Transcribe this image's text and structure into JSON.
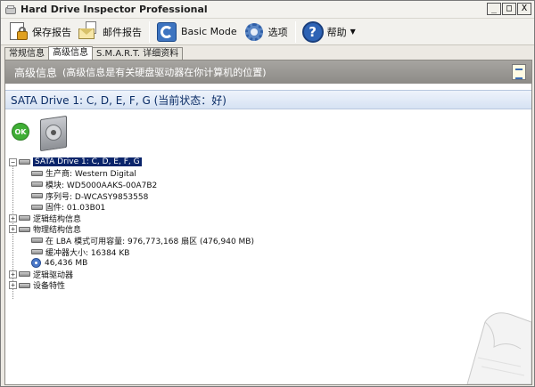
{
  "window": {
    "title": "Hard Drive Inspector Professional"
  },
  "window_buttons": {
    "minimize": "_",
    "maximize": "□",
    "close": "X"
  },
  "toolbar": {
    "save_report": "保存报告",
    "mail_report": "邮件报告",
    "basic_mode": "Basic Mode",
    "options": "选项",
    "help": "帮助"
  },
  "tabs": [
    {
      "label": "常规信息"
    },
    {
      "label": "高级信息"
    },
    {
      "label": "S.M.A.R.T. 详细资料"
    }
  ],
  "header": {
    "title": "高级信息",
    "subtitle": "(高级信息是有关硬盘驱动器在你计算机的位置)"
  },
  "drive_banner": "SATA Drive 1: C, D, E, F, G (当前状态：好)",
  "status_badge": "OK",
  "tree": {
    "root": "SATA Drive 1: C, D, E, F, G",
    "items": [
      {
        "label": "生产商: Western Digital"
      },
      {
        "label": "模块: WD5000AAKS-00A7B2"
      },
      {
        "label": "序列号: D-WCASY9853558"
      },
      {
        "label": "固件: 01.03B01"
      },
      {
        "label": "逻辑结构信息"
      },
      {
        "label": "物理结构信息"
      },
      {
        "label": "在 LBA 模式可用容量: 976,773,168 扇区 (476,940 MB)"
      },
      {
        "label": "缓冲器大小: 16384 KB"
      },
      {
        "label": "46,436 MB"
      },
      {
        "label": "逻辑驱动器"
      },
      {
        "label": "设备特性"
      }
    ]
  }
}
